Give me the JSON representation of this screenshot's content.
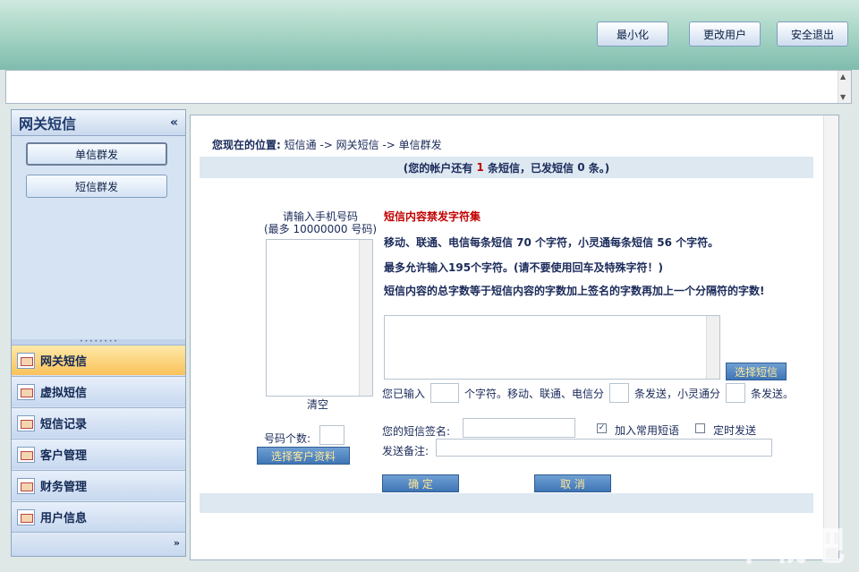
{
  "header": {
    "minimize_label": "最小化",
    "change_user_label": "更改用户",
    "logout_label": "安全退出"
  },
  "sidebar": {
    "title": "网关短信",
    "collapse_glyph": "«",
    "buttons": [
      "单信群发",
      "短信群发"
    ],
    "nav": [
      "网关短信",
      "虚拟短信",
      "短信记录",
      "客户管理",
      "财务管理",
      "用户信息"
    ],
    "expand_glyph": "»"
  },
  "breadcrumb": {
    "prefix": "您现在的位置:",
    "path": "短信通 -> 网关短信 -> 单信群发"
  },
  "account_info": {
    "part1": "(您的帐户还有",
    "remaining": "1",
    "part2": "条短信，已发短信",
    "sent": "0",
    "part3": "条。)"
  },
  "phone_input": {
    "label_line1": "请输入手机号码",
    "label_line2": "(最多 10000000 号码)",
    "clear_label": "清空",
    "count_label": "号码个数:",
    "select_customer_label": "选择客户资料"
  },
  "rules": {
    "title": "短信内容禁发字符集",
    "line1": "移动、联通、电信每条短信 70 个字符，小灵通每条短信 56 个字符。",
    "line2": "最多允许输入195个字符。(请不要使用回车及特殊字符！)",
    "line3": "短信内容的总字数等于短信内容的字数加上签名的字数再加上一个分隔符的字数!"
  },
  "compose": {
    "select_sms_label": "选择短信",
    "typed_prefix": "您已输入",
    "typed_mid": "个字符。移动、联通、电信分",
    "typed_mid2": "条发送，小灵通分",
    "typed_suffix": "条发送。",
    "signature_label": "您的短信签名:",
    "add_common_label": "加入常用短语",
    "add_common_checked": true,
    "scheduled_label": "定时发送",
    "scheduled_checked": false,
    "note_label": "发送备注:",
    "confirm_label": "确  定",
    "cancel_label": "取  消"
  },
  "watermark": "下载吧"
}
